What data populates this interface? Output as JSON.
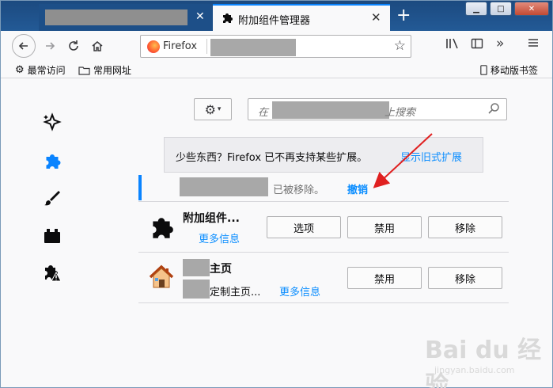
{
  "browser": {
    "tabs": [
      {
        "title": "",
        "active": false
      },
      {
        "title": "附加组件管理器",
        "active": true
      }
    ],
    "url_identity_label": "Firefox",
    "toolbar_icons": [
      "library-icon",
      "sidebar-icon",
      "overflow-icon",
      "menu-icon"
    ],
    "bookmarks": [
      {
        "label": "最常访问",
        "icon": "gear-icon"
      },
      {
        "label": "常用网址",
        "icon": "folder-icon"
      }
    ],
    "mobile_bookmarks": "移动版书签"
  },
  "sidebar": {
    "categories": [
      {
        "icon": "recommendations-icon"
      },
      {
        "icon": "extensions-icon",
        "selected": true
      },
      {
        "icon": "themes-icon"
      },
      {
        "icon": "plugins-icon"
      },
      {
        "icon": "legacy-extensions-icon"
      }
    ]
  },
  "search": {
    "placeholder_prefix": "在",
    "placeholder_suffix": "上搜索"
  },
  "notice": {
    "text": "少些东西？Firefox 已不再支持某些扩展。",
    "link": "显示旧式扩展"
  },
  "removed_bar": {
    "text": "已被移除。",
    "undo": "撤销"
  },
  "addons": [
    {
      "name": "附加组件...",
      "more": "更多信息",
      "buttons": [
        "选项",
        "禁用",
        "移除"
      ]
    },
    {
      "name_suffix": "主页",
      "desc_suffix": "定制主页...",
      "more": "更多信息",
      "buttons": [
        "禁用",
        "移除"
      ]
    }
  ],
  "colors": {
    "accent": "#0a84ff",
    "link": "#0a8dff",
    "annotation_arrow": "#e02020"
  },
  "watermark": {
    "main": "Bai du 经验",
    "sub": "jingyan.baidu.com"
  }
}
